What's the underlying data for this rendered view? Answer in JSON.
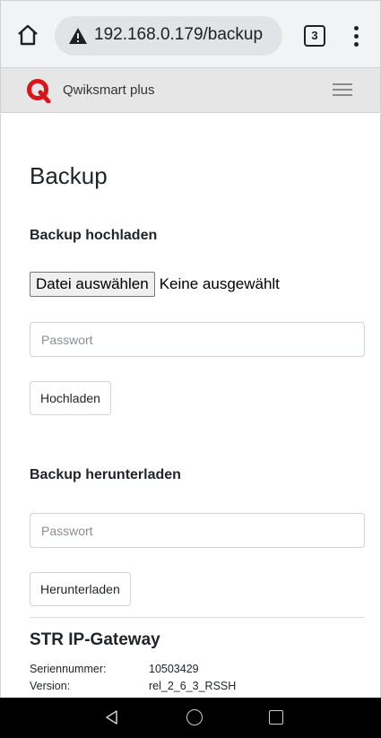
{
  "browser": {
    "url": "192.168.0.179/backup",
    "tab_count": "3",
    "icons": [
      "home-icon",
      "warning-icon",
      "tabs-icon",
      "more-vert-icon"
    ]
  },
  "app": {
    "brand": "Qwiksmart plus",
    "logo_color": "#d9151b",
    "icons": [
      "q-logo-icon",
      "hamburger-menu-icon"
    ]
  },
  "page": {
    "title": "Backup",
    "upload": {
      "heading": "Backup hochladen",
      "file_button_label": "Datei auswählen",
      "file_status": "Keine ausgewählt",
      "password_placeholder": "Passwort",
      "submit_label": "Hochladen"
    },
    "download": {
      "heading": "Backup herunterladen",
      "password_placeholder": "Passwort",
      "submit_label": "Herunterladen"
    },
    "device": {
      "title": "STR IP-Gateway",
      "serial_label": "Seriennummer:",
      "serial_value": "10503429",
      "version_label": "Version:",
      "version_value": "rel_2_6_3_RSSH"
    }
  },
  "system_nav": {
    "icons": [
      "back-icon",
      "home-circle-icon",
      "recents-icon"
    ]
  }
}
